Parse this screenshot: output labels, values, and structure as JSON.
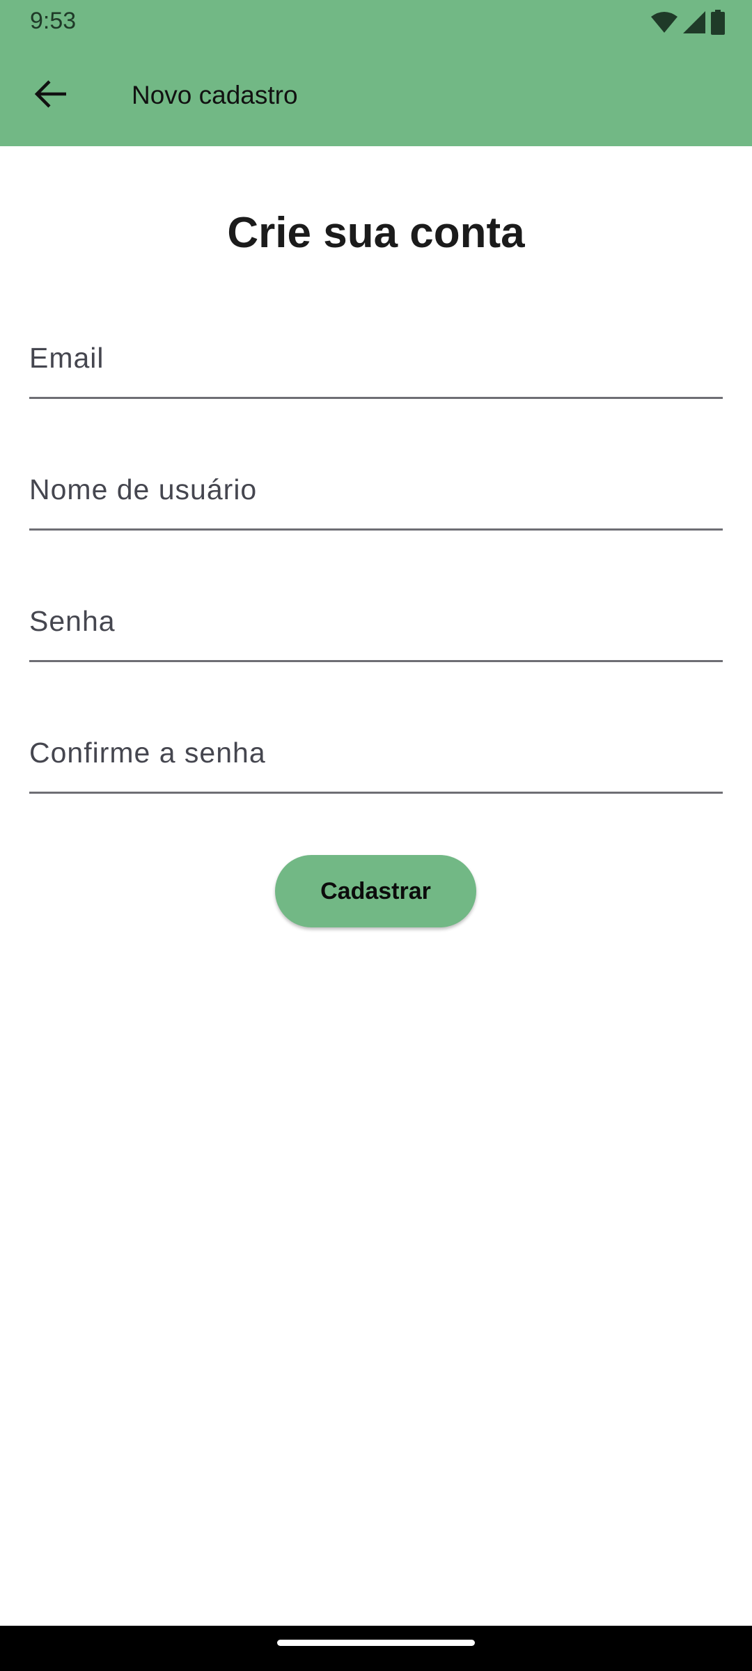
{
  "status_bar": {
    "time": "9:53",
    "icons": [
      "wifi-icon",
      "cellular-signal-icon",
      "battery-icon"
    ]
  },
  "app_bar": {
    "back_icon": "arrow-back-icon",
    "title": "Novo cadastro"
  },
  "page": {
    "title": "Crie sua conta"
  },
  "form": {
    "fields": [
      {
        "name": "email",
        "placeholder": "Email",
        "value": ""
      },
      {
        "name": "username",
        "placeholder": "Nome de usuário",
        "value": ""
      },
      {
        "name": "password",
        "placeholder": "Senha",
        "value": ""
      },
      {
        "name": "confirm_password",
        "placeholder": "Confirme a senha",
        "value": ""
      }
    ],
    "submit_label": "Cadastrar"
  },
  "colors": {
    "primary": "#72b885",
    "text": "#1b1b1b",
    "field_label": "#45464f",
    "underline": "#6e6e74"
  }
}
